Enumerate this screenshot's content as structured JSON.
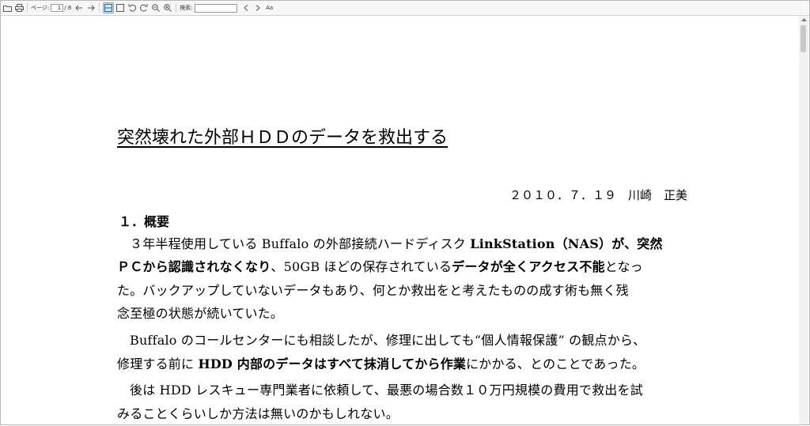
{
  "toolbar": {
    "page_label": "ページ:",
    "page_value": "1",
    "page_total": "/ 8",
    "search_label": "検索:",
    "search_value": "",
    "font_button": "Aa"
  },
  "document": {
    "title": "突然壊れた外部ＨＤＤのデータを救出する",
    "date_author": "２０１０．７．１９　川崎　正美",
    "section_heading": "１．概要",
    "lines": [
      {
        "a": "３年半程使用している Buffalo の外部接続ハードディスク ",
        "b": "LinkStation（NAS）が、突然"
      },
      {
        "a": "ＰＣから認識されなくなり",
        "b": "、50GB ほどの保存されている",
        "c": "データが全くアクセス不能",
        "d": "となっ"
      },
      {
        "a": "た。バックアップしていないデータもあり、何とか救出をと考えたものの成す術も無く残"
      },
      {
        "a": "念至極の状態が続いていた。"
      },
      {
        "a": "Buffalo のコールセンターにも相談したが、修理に出しても“個人情報保護” の観点から、"
      },
      {
        "a": "修理する前に ",
        "b": "HDD 内部のデータはすべて抹消してから作業",
        "c": "にかかる、とのことであった。"
      },
      {
        "a": "後は HDD レスキュー専門業者に依頼して、最悪の場合数１０万円規模の費用で救出を試"
      },
      {
        "a": "みることくらいしか方法は無いのかもしれない。"
      }
    ]
  }
}
